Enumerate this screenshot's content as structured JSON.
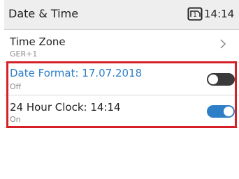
{
  "header": {
    "title": "Date & Time",
    "status_icon": "sim-card-1-icon",
    "time": "14:14"
  },
  "settings": [
    {
      "title": "Time Zone",
      "subtitle": "GER+1",
      "control": "chevron"
    },
    {
      "title": "Date Format: 17.07.2018",
      "subtitle": "Off",
      "control": "toggle",
      "enabled": false
    },
    {
      "title": "24 Hour Clock: 14:14",
      "subtitle": "On",
      "control": "toggle",
      "enabled": true
    }
  ],
  "colors": {
    "accent": "#2f7fc7",
    "highlight": "#d42026",
    "toggle_off": "#3a3a3a"
  }
}
